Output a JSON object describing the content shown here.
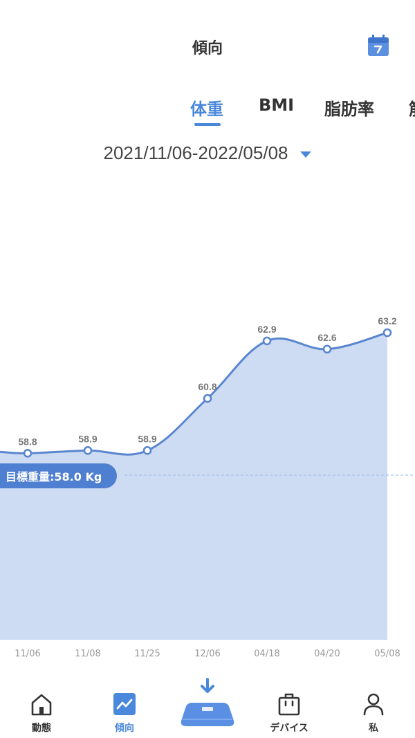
{
  "header": {
    "title": "傾向",
    "calendar_icon": "calendar-icon"
  },
  "tabs": [
    {
      "label": "体重",
      "active": true
    },
    {
      "label": "BMI",
      "active": false
    },
    {
      "label": "脂肪率",
      "active": false
    },
    {
      "label": "筋",
      "active": false
    }
  ],
  "date_range": {
    "text": "2021/11/06-2022/05/08",
    "caret_icon": "caret-down-icon"
  },
  "goal": {
    "label": "目標重量:58.0 Kg",
    "value": 58.0
  },
  "chart_data": {
    "type": "area",
    "categories": [
      "11/06",
      "11/08",
      "11/25",
      "12/06",
      "04/18",
      "04/20",
      "05/08"
    ],
    "values": [
      58.8,
      58.9,
      58.9,
      60.8,
      62.9,
      62.6,
      63.2
    ],
    "data_labels": [
      "58.8",
      "58.9",
      "58.9",
      "60.8",
      "62.9",
      "62.6",
      "63.2"
    ],
    "reference_line": 58.0,
    "grid": false,
    "colors": {
      "line": "#5a86cf",
      "fill": "#cddcf2",
      "point_fill": "#ffffff",
      "goal": "#4f7fd0",
      "goal_line": "#a9c3ea"
    }
  },
  "nav": [
    {
      "label": "動態",
      "icon": "home-icon",
      "active": false
    },
    {
      "label": "傾向",
      "icon": "trend-icon",
      "active": true
    },
    {
      "label": "",
      "icon": "scale-icon",
      "active": false
    },
    {
      "label": "デバイス",
      "icon": "device-bag-icon",
      "active": false
    },
    {
      "label": "私",
      "icon": "person-icon",
      "active": false
    }
  ],
  "colors": {
    "accent": "#4a88db",
    "text": "#333333"
  }
}
